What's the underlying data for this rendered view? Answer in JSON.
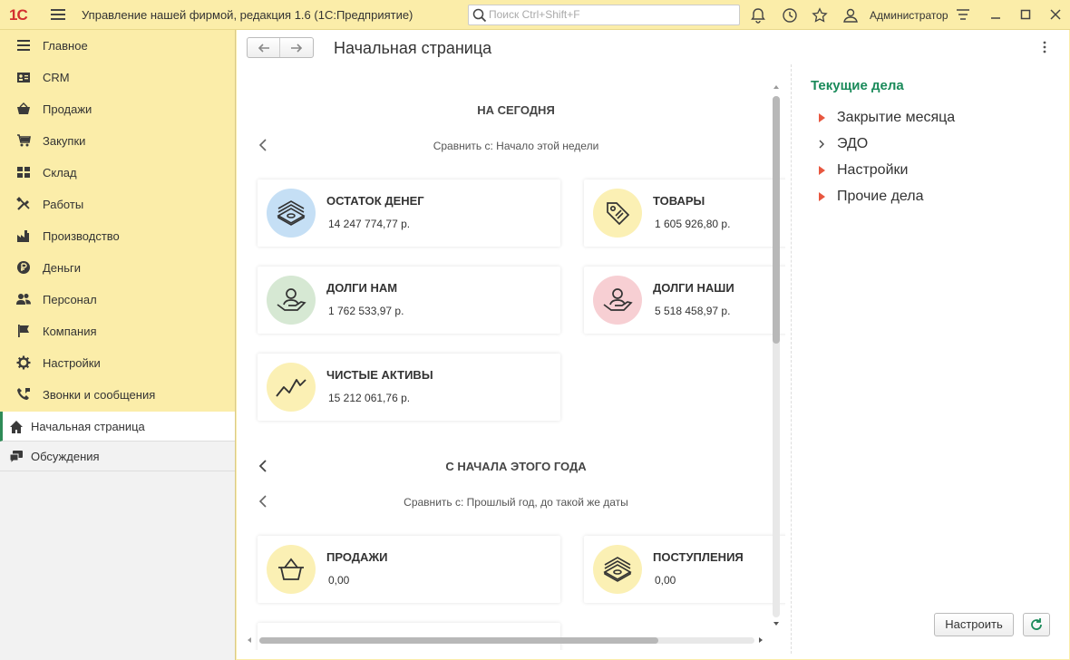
{
  "titlebar": {
    "logo": "1С",
    "title": "Управление нашей фирмой, редакция 1.6  (1С:Предприятие)",
    "search_placeholder": "Поиск Ctrl+Shift+F",
    "user": "Администратор"
  },
  "sidebar": {
    "items": [
      {
        "label": "Главное",
        "icon": "menu-lines-icon"
      },
      {
        "label": "CRM",
        "icon": "contact-card-icon"
      },
      {
        "label": "Продажи",
        "icon": "basket-icon"
      },
      {
        "label": "Закупки",
        "icon": "cart-icon"
      },
      {
        "label": "Склад",
        "icon": "warehouse-grid-icon"
      },
      {
        "label": "Работы",
        "icon": "tools-icon"
      },
      {
        "label": "Производство",
        "icon": "factory-icon"
      },
      {
        "label": "Деньги",
        "icon": "ruble-coin-icon"
      },
      {
        "label": "Персонал",
        "icon": "people-icon"
      },
      {
        "label": "Компания",
        "icon": "flag-icon"
      },
      {
        "label": "Настройки",
        "icon": "gear-icon"
      },
      {
        "label": "Звонки и сообщения",
        "icon": "phone-icon"
      }
    ],
    "open_windows": [
      {
        "label": "Начальная страница",
        "icon": "home-icon",
        "active": true
      },
      {
        "label": "Обсуждения",
        "icon": "chat-icon",
        "active": false
      }
    ]
  },
  "main": {
    "page_title": "Начальная страница",
    "today": {
      "heading": "НА СЕГОДНЯ",
      "compare": "Сравнить с: Начало этой недели",
      "cards": [
        {
          "title": "ОСТАТОК ДЕНЕГ",
          "value": "14 247 774,77 р.",
          "icon": "money-stack-icon",
          "color": "#c5dff5"
        },
        {
          "title": "ТОВАРЫ",
          "value": "1 605 926,80 р.",
          "icon": "price-tag-icon",
          "color": "#fbf0b4"
        },
        {
          "title": "ДОЛГИ НАМ",
          "value": "1 762 533,97 р.",
          "icon": "hand-person-icon",
          "color": "#d6e8d3"
        },
        {
          "title": "ДОЛГИ НАШИ",
          "value": "5 518 458,97 р.",
          "icon": "hand-person-icon",
          "color": "#f7cfd3"
        },
        {
          "title": "ЧИСТЫЕ АКТИВЫ",
          "value": "15 212 061,76 р.",
          "icon": "zigzag-chart-icon",
          "color": "#fbf0b4"
        }
      ]
    },
    "year": {
      "heading": "С НАЧАЛА ЭТОГО ГОДА",
      "compare": "Сравнить с: Прошлый год, до такой же даты",
      "cards": [
        {
          "title": "ПРОДАЖИ",
          "value": "0,00",
          "icon": "basket-icon",
          "color": "#fbf0b4"
        },
        {
          "title": "ПОСТУПЛЕНИЯ",
          "value": "0,00",
          "icon": "money-stack-icon",
          "color": "#fbf0b4"
        }
      ]
    }
  },
  "right_panel": {
    "title": "Текущие дела",
    "items": [
      {
        "label": "Закрытие месяца",
        "marker": "red-triangle"
      },
      {
        "label": "ЭДО",
        "marker": "chevron"
      },
      {
        "label": "Настройки",
        "marker": "red-triangle"
      },
      {
        "label": "Прочие дела",
        "marker": "red-triangle"
      }
    ],
    "setup_button": "Настроить"
  },
  "colors": {
    "sidebar_bg": "#fbeda9",
    "accent_green": "#1a8a5a",
    "logo_red": "#d32f2f",
    "marker_red": "#e8573f"
  }
}
